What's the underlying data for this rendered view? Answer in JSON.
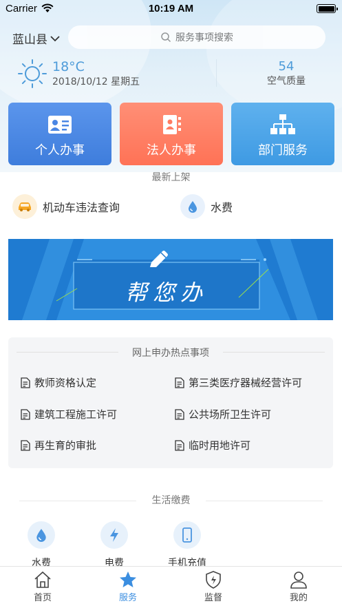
{
  "status_bar": {
    "carrier": "Carrier",
    "time": "10:19 AM"
  },
  "header": {
    "location": "蓝山县",
    "search_placeholder": "服务事项搜索"
  },
  "weather": {
    "temperature": "18°C",
    "date": "2018/10/12 星期五",
    "aqi_value": "54",
    "aqi_label": "空气质量"
  },
  "action_cards": [
    {
      "label": "个人办事",
      "icon": "id-card-icon"
    },
    {
      "label": "法人办事",
      "icon": "contact-book-icon"
    },
    {
      "label": "部门服务",
      "icon": "org-chart-icon"
    }
  ],
  "new_section": {
    "title": "最新上架",
    "items": [
      {
        "label": "机动车违法查询",
        "icon": "car-icon"
      },
      {
        "label": "水费",
        "icon": "water-drop-icon"
      }
    ]
  },
  "banner": {
    "text": "帮您办",
    "icon": "pencil-icon"
  },
  "hot_section": {
    "title": "网上申办热点事项",
    "items": [
      "教师资格认定",
      "第三类医疗器械经营许可",
      "建筑工程施工许可",
      "公共场所卫生许可",
      "再生育的审批",
      "临时用地许可"
    ]
  },
  "life_section": {
    "title": "生活缴费",
    "items": [
      {
        "label": "水费",
        "icon": "water-drop-icon"
      },
      {
        "label": "电费",
        "icon": "lightning-icon"
      },
      {
        "label": "手机充值",
        "icon": "phone-icon"
      }
    ]
  },
  "tabbar": {
    "tabs": [
      {
        "label": "首页",
        "icon": "home-icon"
      },
      {
        "label": "服务",
        "icon": "star-icon",
        "active": true
      },
      {
        "label": "监督",
        "icon": "shield-icon"
      },
      {
        "label": "我的",
        "icon": "user-icon"
      }
    ]
  },
  "colors": {
    "accent": "#3b8ee0",
    "card_personal": "#4a86e4",
    "card_legal": "#ff7c62",
    "card_department": "#4aa5e8",
    "banner": "#2f8fe0"
  }
}
